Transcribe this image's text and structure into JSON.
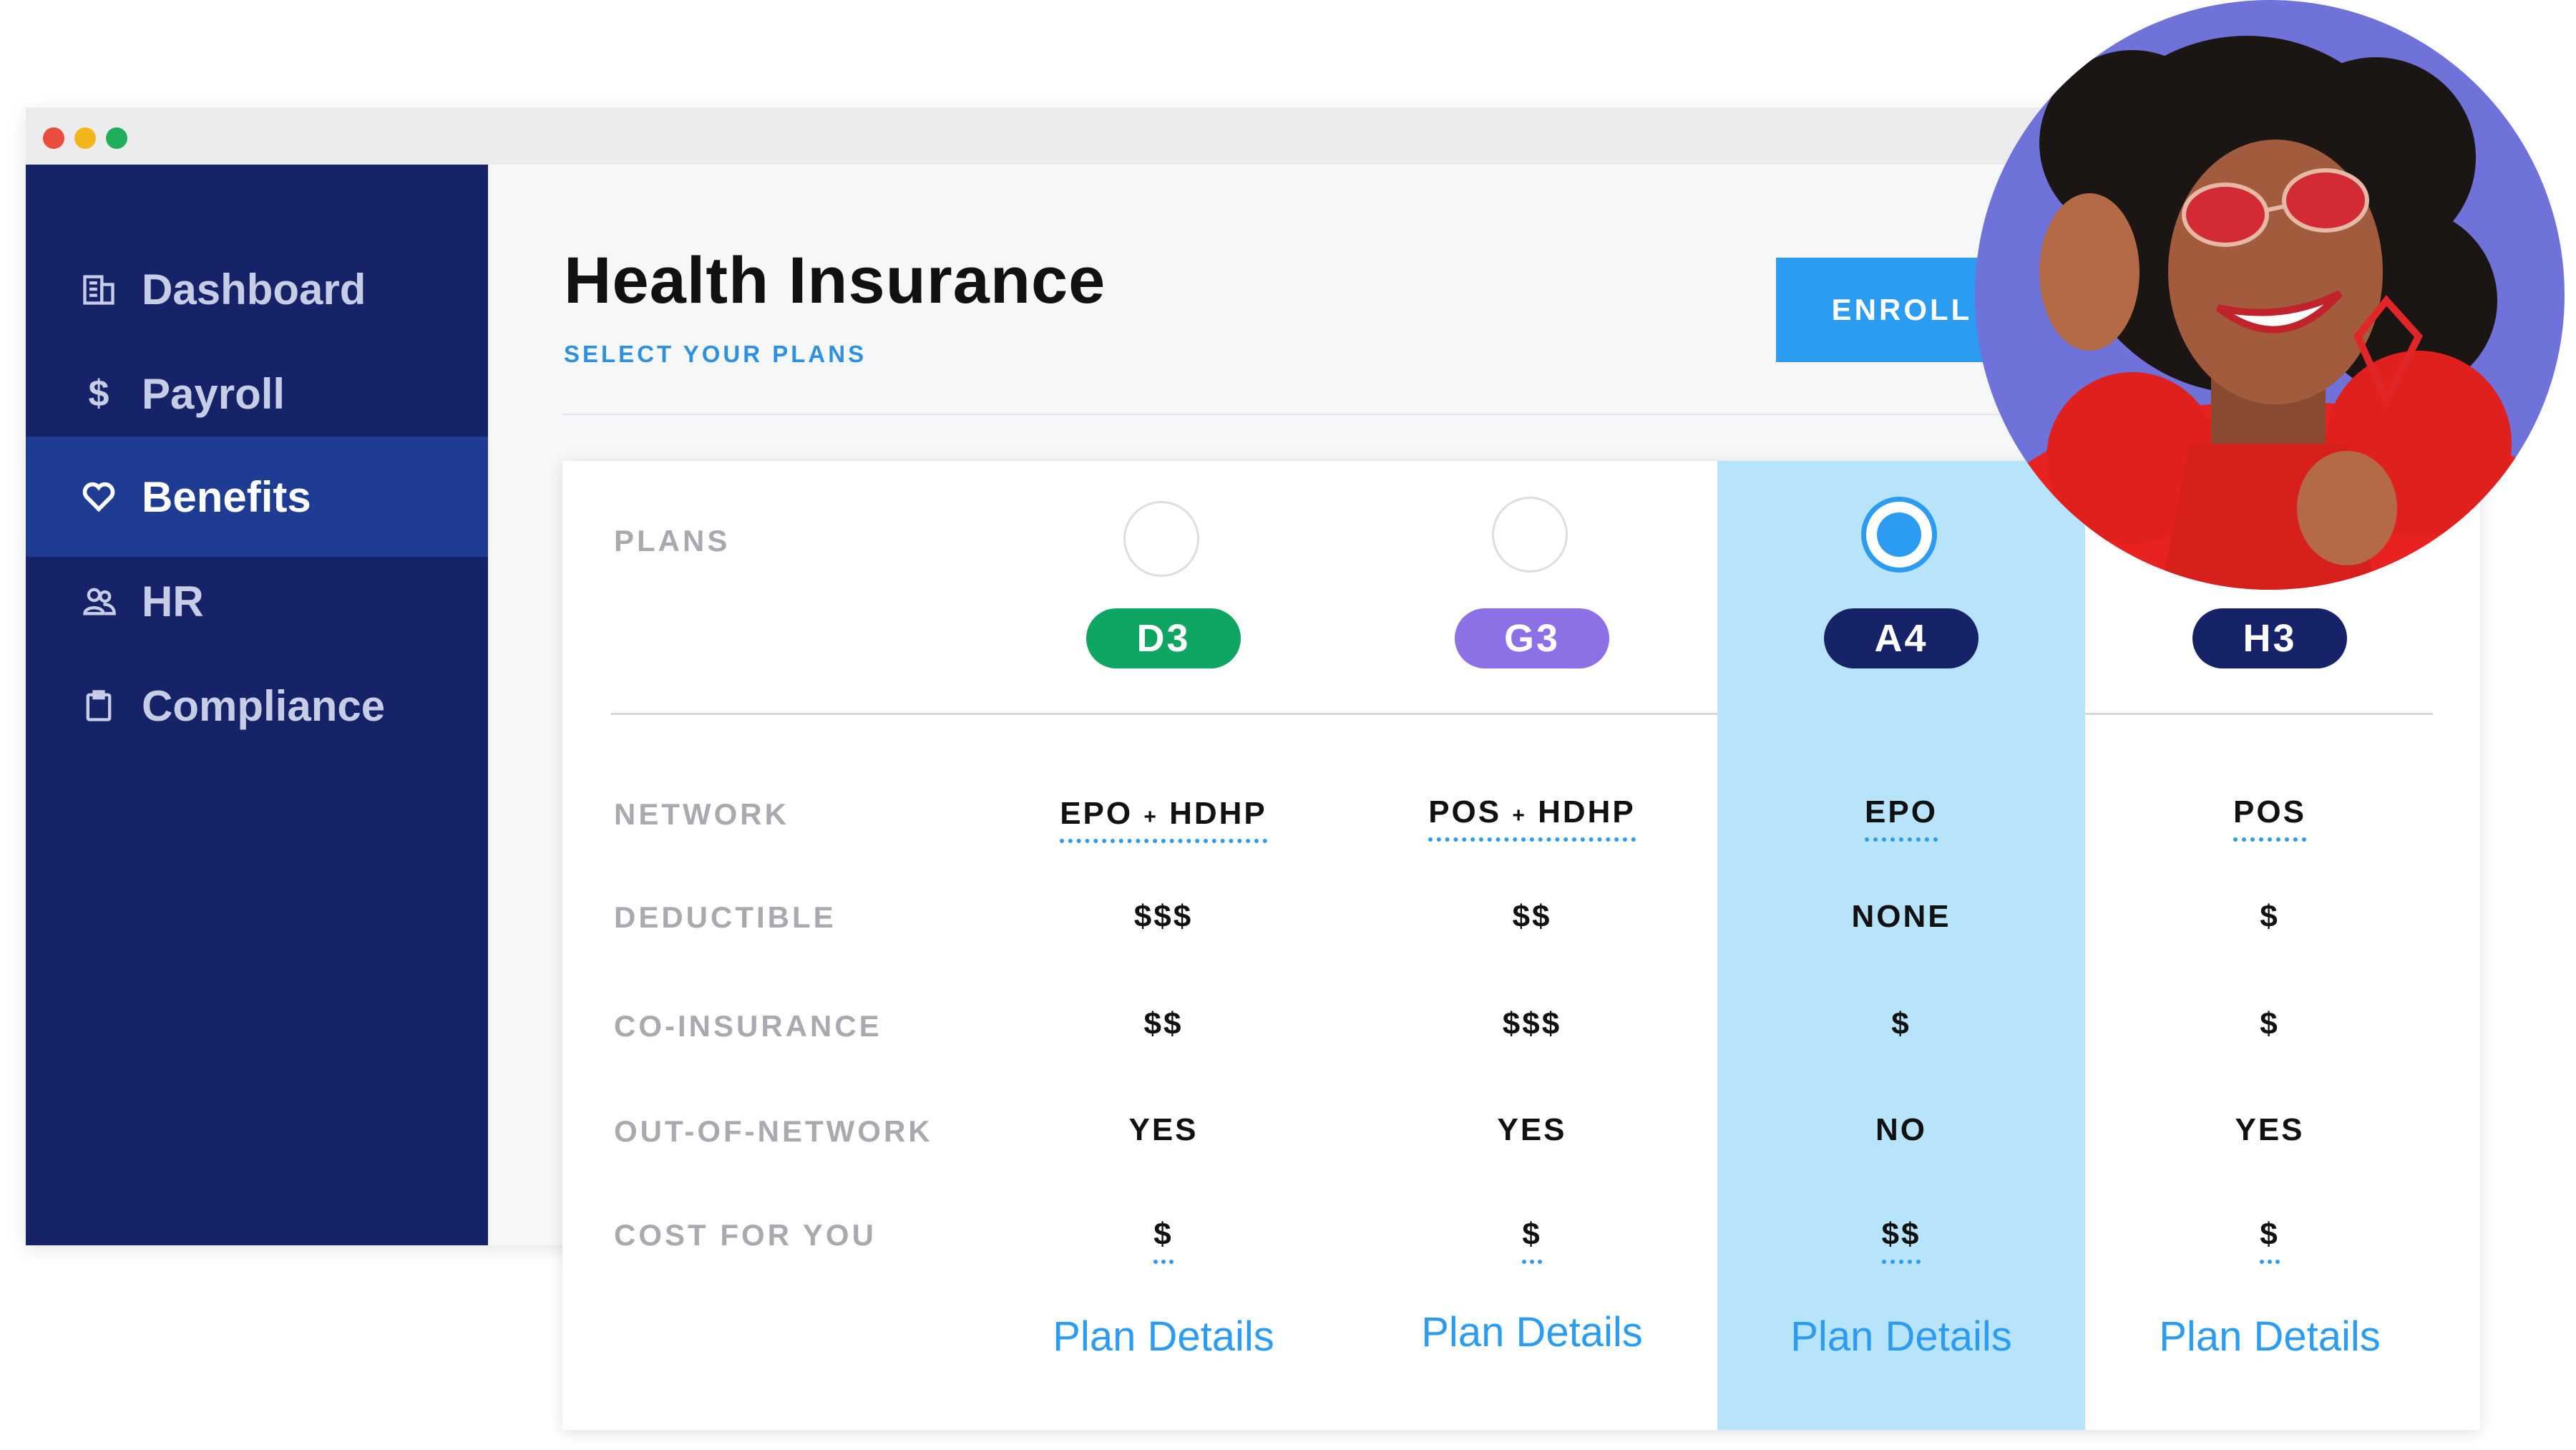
{
  "app": {
    "sidebar": {
      "items": [
        {
          "label": "Dashboard",
          "icon": "building-icon",
          "active": false
        },
        {
          "label": "Payroll",
          "icon": "dollar-icon",
          "active": false
        },
        {
          "label": "Benefits",
          "icon": "heart-icon",
          "active": true
        },
        {
          "label": "HR",
          "icon": "people-icon",
          "active": false
        },
        {
          "label": "Compliance",
          "icon": "clipboard-icon",
          "active": false
        }
      ]
    },
    "header": {
      "title": "Health Insurance",
      "subtitle": "SELECT YOUR PLANS",
      "enroll_label": "ENROLL"
    },
    "plans_table": {
      "row_labels": {
        "plans": "PLANS",
        "network": "NETWORK",
        "deductible": "DEDUCTIBLE",
        "coinsurance": "CO-INSURANCE",
        "out_of_network": "OUT-OF-NETWORK",
        "cost": "COST FOR YOU"
      },
      "plans": [
        {
          "code": "D3",
          "color": "#0fa563",
          "selected": false,
          "network_a": "EPO",
          "network_sep": "+",
          "network_b": "HDHP",
          "deductible": "$$$",
          "coinsurance": "$$",
          "out_of_network": "YES",
          "cost": "$",
          "details_label": "Plan Details"
        },
        {
          "code": "G3",
          "color": "#8e70e6",
          "selected": false,
          "network_a": "POS",
          "network_sep": "+",
          "network_b": "HDHP",
          "deductible": "$$",
          "coinsurance": "$$$",
          "out_of_network": "YES",
          "cost": "$",
          "details_label": "Plan Details"
        },
        {
          "code": "A4",
          "color": "#172368",
          "selected": true,
          "network_a": "EPO",
          "network_sep": "",
          "network_b": "",
          "deductible": "NONE",
          "coinsurance": "$",
          "out_of_network": "NO",
          "cost": "$$",
          "details_label": "Plan Details"
        },
        {
          "code": "H3",
          "color": "#172368",
          "selected": false,
          "network_a": "POS",
          "network_sep": "",
          "network_b": "",
          "deductible": "$",
          "coinsurance": "$",
          "out_of_network": "YES",
          "cost": "$",
          "details_label": "Plan Details"
        }
      ]
    },
    "colors": {
      "sidebar_bg": "#172368",
      "sidebar_active": "#1e3d92",
      "accent": "#2b9cf2",
      "selected_column": "#b7e3fb"
    },
    "avatar": {
      "icon": "person-photo"
    }
  }
}
